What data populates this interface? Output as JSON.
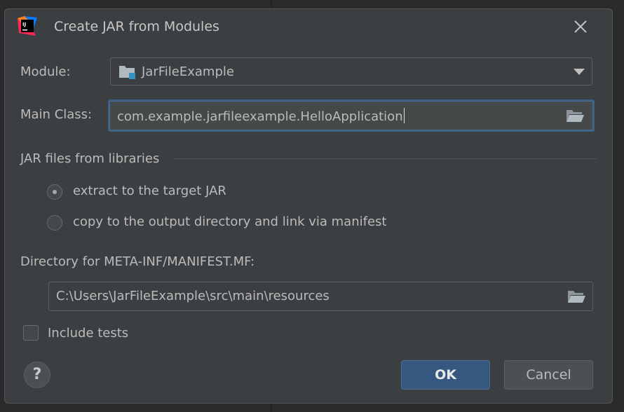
{
  "dialog": {
    "title": "Create JAR from Modules",
    "app_icon": "intellij-idea-icon",
    "close_icon": "close-icon"
  },
  "module": {
    "label": "Module:",
    "value": "JarFileExample",
    "icon": "module-folder-icon"
  },
  "main_class": {
    "label": "Main Class:",
    "value": "com.example.jarfileexample.HelloApplication",
    "browse_icon": "open-folder-icon"
  },
  "libraries": {
    "section_title": "JAR files from libraries",
    "options": [
      {
        "label": "extract to the target JAR",
        "selected": true
      },
      {
        "label": "copy to the output directory and link via manifest",
        "selected": false
      }
    ]
  },
  "manifest": {
    "label": "Directory for META-INF/MANIFEST.MF:",
    "value": "C:\\Users\\JarFileExample\\src\\main\\resources",
    "browse_icon": "open-folder-icon"
  },
  "include_tests": {
    "label": "Include tests",
    "checked": false
  },
  "buttons": {
    "help": "?",
    "ok": "OK",
    "cancel": "Cancel"
  },
  "colors": {
    "dialog_bg": "#3c3f41",
    "accent": "#365880",
    "focus_border": "#3d6185",
    "text": "#bbbbbb"
  }
}
